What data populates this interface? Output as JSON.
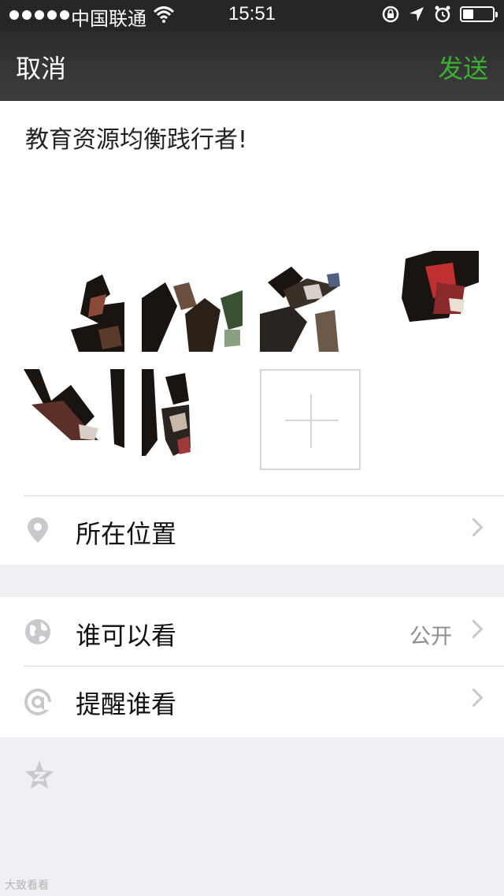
{
  "status_bar": {
    "carrier": "中国联通",
    "time": "15:51",
    "battery_level": 0.35
  },
  "nav": {
    "cancel_label": "取消",
    "send_label": "发送"
  },
  "post": {
    "text": "教育资源均衡践行者!"
  },
  "options": {
    "location_label": "所在位置",
    "visibility_label": "谁可以看",
    "visibility_value": "公开",
    "mention_label": "提醒谁看"
  },
  "watermark": "大致看看",
  "colors": {
    "send_green": "#3cb034",
    "nav_bg": "#333333",
    "icon_gray": "#c8c8cd"
  }
}
